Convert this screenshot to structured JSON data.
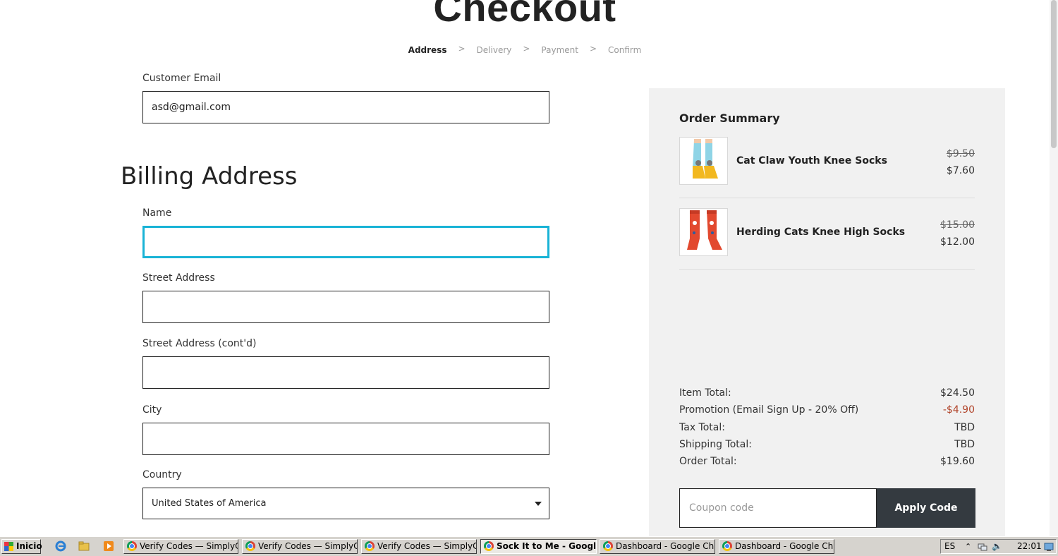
{
  "header": {
    "title": "Checkout",
    "steps": [
      "Address",
      "Delivery",
      "Payment",
      "Confirm"
    ],
    "separator": ">"
  },
  "form": {
    "email_label": "Customer Email",
    "email_value": "asd@gmail.com",
    "billing_title": "Billing Address",
    "name_label": "Name",
    "name_value": "",
    "street_label": "Street Address",
    "street2_label": "Street Address (cont'd)",
    "city_label": "City",
    "country_label": "Country",
    "country_value": "United States of America"
  },
  "summary": {
    "title": "Order Summary",
    "items": [
      {
        "name": "Cat Claw Youth Knee Socks",
        "old_price": "$9.50",
        "price": "$7.60"
      },
      {
        "name": "Herding Cats Knee High Socks",
        "old_price": "$15.00",
        "price": "$12.00"
      }
    ],
    "totals": [
      {
        "label": "Item Total:",
        "value": "$24.50"
      },
      {
        "label": "Promotion (Email Sign Up - 20% Off)",
        "value": "-$4.90"
      },
      {
        "label": "Tax Total:",
        "value": "TBD"
      },
      {
        "label": "Shipping Total:",
        "value": "TBD"
      },
      {
        "label": "Order Total:",
        "value": "$19.60"
      }
    ],
    "coupon_placeholder": "Coupon code",
    "apply_label": "Apply Code"
  },
  "taskbar": {
    "start_label": "Inicio",
    "tasks": [
      "Verify Codes — SimplyCo...",
      "Verify Codes — SimplyCo...",
      "Verify Codes — SimplyCo...",
      "Sock It to Me - Googl...",
      "Dashboard - Google Chr...",
      "Dashboard - Google Chr..."
    ],
    "language": "ES",
    "clock": "22:01"
  },
  "colors": {
    "focus_border": "#19b3d6",
    "promotion_negative": "#b2462c",
    "apply_button_bg": "#343a40",
    "summary_bg": "#f1f1f1"
  }
}
